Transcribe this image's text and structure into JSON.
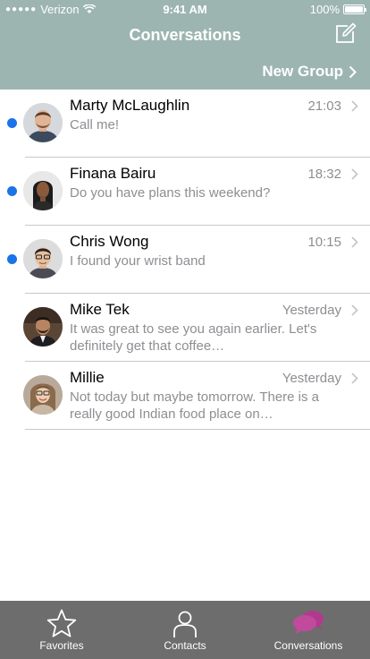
{
  "status_bar": {
    "carrier": "Verizon",
    "time": "9:41 AM",
    "battery": "100%"
  },
  "nav": {
    "title": "Conversations",
    "new_group_label": "New Group"
  },
  "conversations": [
    {
      "name": "Marty McLaughlin",
      "time": "21:03",
      "preview": "Call me!",
      "unread": true
    },
    {
      "name": "Finana Bairu",
      "time": "18:32",
      "preview": "Do you have plans this weekend?",
      "unread": true
    },
    {
      "name": "Chris Wong",
      "time": "10:15",
      "preview": "I found your wrist band",
      "unread": true
    },
    {
      "name": "Mike Tek",
      "time": "Yesterday",
      "preview": "It was great to see you again earlier. Let's definitely get that coffee…",
      "unread": false
    },
    {
      "name": "Millie",
      "time": "Yesterday",
      "preview": "Not today but maybe tomorrow. There is a really good Indian food place on…",
      "unread": false
    }
  ],
  "tabbar": {
    "tabs": [
      {
        "label": "Favorites",
        "icon": "star-icon"
      },
      {
        "label": "Contacts",
        "icon": "person-icon"
      },
      {
        "label": "Conversations",
        "icon": "chat-bubbles-icon",
        "active": true
      }
    ]
  },
  "colors": {
    "header": "#9db5b0",
    "unread_dot": "#1a73e8",
    "active_tab_icon": "#b03a8e",
    "tabbar": "#6d6d6d"
  }
}
